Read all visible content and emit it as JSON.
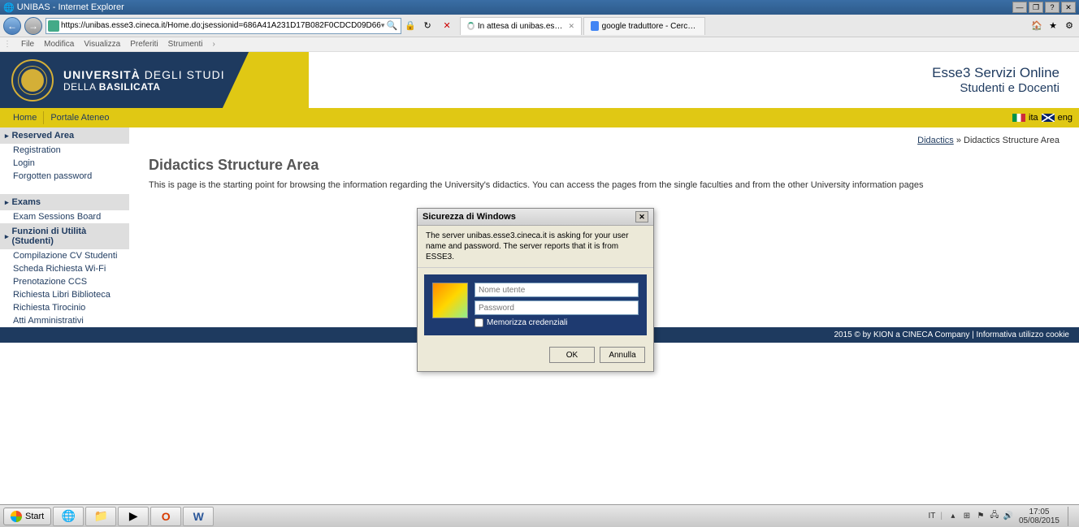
{
  "titlebar": {
    "text": "UNIBAS - Internet Explorer"
  },
  "ie": {
    "url": "https://unibas.esse3.cineca.it/Home.do;jsessionid=686A41A231D17B082F0CDCD09D66",
    "tab1": "In attesa di unibas.esse3.cin...",
    "tab2": "google traduttore - Cerca con G..."
  },
  "menubar": {
    "file": "File",
    "modifica": "Modifica",
    "visualizza": "Visualizza",
    "preferiti": "Preferiti",
    "strumenti": "Strumenti"
  },
  "banner": {
    "line1": "UNIVERSITÀ",
    "line1b": "DEGLI STUDI",
    "line2": "DELLA",
    "line2b": "BASILICATA",
    "right1": "Esse3 Servizi Online",
    "right2": "Studenti e Docenti"
  },
  "navbar": {
    "home": "Home",
    "portale": "Portale Ateneo",
    "ita": "ita",
    "eng": "eng"
  },
  "sidebar": {
    "g1": "Reserved Area",
    "g1_items": [
      "Registration",
      "Login",
      "Forgotten password"
    ],
    "g2": "Exams",
    "g2_items": [
      "Exam Sessions Board"
    ],
    "g3": "Funzioni di Utilità (Studenti)",
    "g3_items": [
      "Compilazione CV Studenti",
      "Scheda Richiesta Wi-Fi",
      "Prenotazione CCS",
      "Richiesta Libri Biblioteca",
      "Richiesta Tirocinio",
      "Atti Amministrativi"
    ]
  },
  "breadcrumb": {
    "link": "Didactics",
    "sep": " » ",
    "current": "Didactics Structure Area"
  },
  "page": {
    "title": "Didactics Structure Area",
    "desc": "This is page is the starting point for browsing the information regarding the University's didactics. You can access the pages from the single faculties and from the other University information pages"
  },
  "dialog": {
    "title": "Sicurezza di Windows",
    "msg": "The server unibas.esse3.cineca.it is asking for your user name and password. The server reports that it is from ESSE3.",
    "user_ph": "Nome utente",
    "pass_ph": "Password",
    "remember": "Memorizza credenziali",
    "ok": "OK",
    "cancel": "Annulla"
  },
  "footer": {
    "copy": "2015 © by KION a CINECA Company",
    "sep": " | ",
    "cookie": "Informativa utilizzo cookie"
  },
  "taskbar": {
    "start": "Start",
    "lang": "IT",
    "time": "17:05",
    "date": "05/08/2015"
  }
}
